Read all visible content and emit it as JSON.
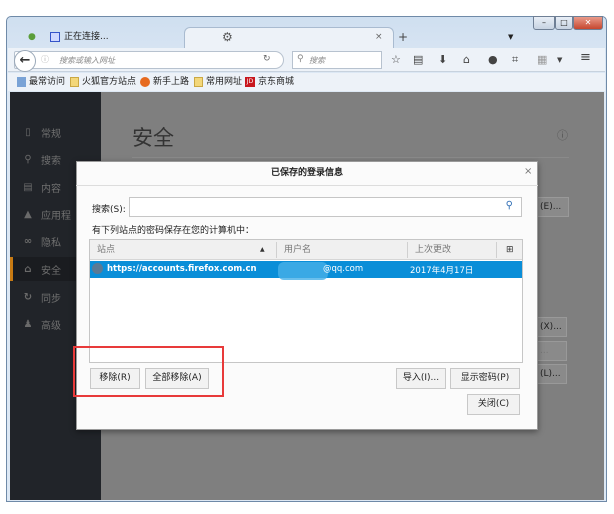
{
  "browser": {
    "tabs": [
      {
        "label": "正在连接..."
      },
      {
        "label": ""
      }
    ],
    "url_placeholder": "搜索或输入网址",
    "search_placeholder": "搜索",
    "bookmarks": [
      "最常访问",
      "火狐官方站点",
      "新手上路",
      "常用网址",
      "京东商城"
    ]
  },
  "sidebar": {
    "items": [
      {
        "label": "常规",
        "icon": "general-icon"
      },
      {
        "label": "搜索",
        "icon": "search-icon"
      },
      {
        "label": "内容",
        "icon": "content-icon"
      },
      {
        "label": "应用程",
        "icon": "applications-icon"
      },
      {
        "label": "隐私",
        "icon": "privacy-mask-icon"
      },
      {
        "label": "安全",
        "icon": "lock-icon",
        "selected": true
      },
      {
        "label": "同步",
        "icon": "sync-icon"
      },
      {
        "label": "高级",
        "icon": "advanced-icon"
      }
    ]
  },
  "page": {
    "title": "安全",
    "bg_buttons": [
      "(E)...",
      "(X)...",
      "...",
      "(L)..."
    ]
  },
  "dialog": {
    "title": "已保存的登录信息",
    "search_label": "搜索(S):",
    "search_value": "",
    "description": "有下列站点的密码保存在您的计算机中：",
    "columns": [
      "站点",
      "用户名",
      "上次更改"
    ],
    "rows": [
      {
        "site": "https://accounts.firefox.com.cn",
        "username": "@qq.com",
        "changed": "2017年4月17日"
      }
    ],
    "buttons": {
      "remove": "移除(R)",
      "remove_all": "全部移除(A)",
      "import": "导入(I)...",
      "show_passwords": "显示密码(P)",
      "close": "关闭(C)"
    }
  },
  "colors": {
    "selection": "#0a8ed8",
    "highlight": "#e83a3a",
    "sidebar_accent": "#c77a13"
  }
}
